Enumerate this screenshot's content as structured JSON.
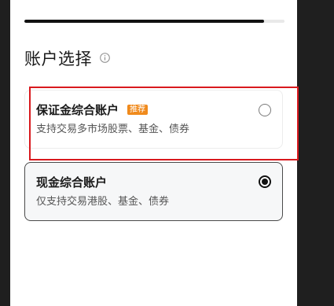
{
  "progress": {
    "fraction": 0.92
  },
  "section": {
    "title": "账户选择",
    "info_icon": "info-circle-icon"
  },
  "accounts": [
    {
      "title": "保证金综合账户",
      "badge": "推荐",
      "subtitle": "支持交易多市场股票、基金、债券",
      "selected": false
    },
    {
      "title": "现金综合账户",
      "subtitle": "仅支持交易港股、基金、债券",
      "selected": true
    }
  ],
  "colors": {
    "badge": "#f08a1c",
    "highlight": "#d9191e",
    "selected_radio": "#111111"
  }
}
